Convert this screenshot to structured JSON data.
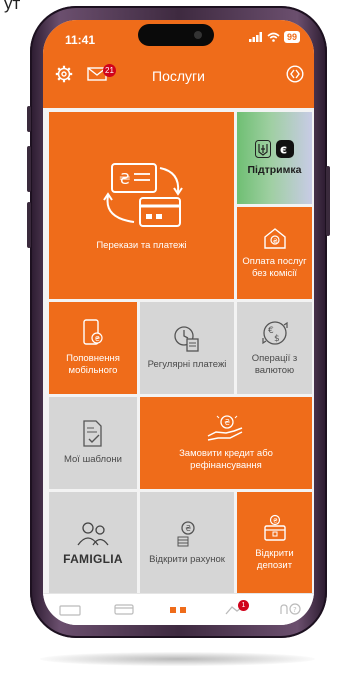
{
  "caption": "ут",
  "status_bar": {
    "time": "11:41",
    "battery": "99"
  },
  "header": {
    "title": "Послуги",
    "mail_badge": "21"
  },
  "tiles": [
    {
      "id": "transfers",
      "label": "Перекази та платежі"
    },
    {
      "id": "support",
      "label": "Підтримка"
    },
    {
      "id": "utilities",
      "label": "Оплата послуг без комісії"
    },
    {
      "id": "mobile",
      "label": "Поповнення мобільного"
    },
    {
      "id": "regular",
      "label": "Регулярні платежі"
    },
    {
      "id": "currency",
      "label": "Операції з валютою"
    },
    {
      "id": "templates",
      "label": "Мої шаблони"
    },
    {
      "id": "credit",
      "label": "Замовити кредит або рефінансування"
    },
    {
      "id": "famiglia",
      "label": "FAMIGLIA"
    },
    {
      "id": "open_account",
      "label": "Відкрити рахунок"
    },
    {
      "id": "open_deposit",
      "label": "Відкрити депозит"
    }
  ],
  "bottom_nav": {
    "notification_badge": "1"
  },
  "icons": [
    "settings-icon",
    "mail-icon",
    "toggle-icon",
    "transfer-icon",
    "ukraine-trident-icon",
    "e-logo-icon",
    "house-icon",
    "phone-icon",
    "calendar-doc-icon",
    "currency-exchange-icon",
    "document-check-icon",
    "hand-coin-icon",
    "family-icon",
    "coin-stack-icon",
    "safe-deposit-icon"
  ],
  "colors": {
    "accent": "#ef6c1a",
    "tile_grey": "#d6d6d6",
    "badge": "#d0021b"
  }
}
